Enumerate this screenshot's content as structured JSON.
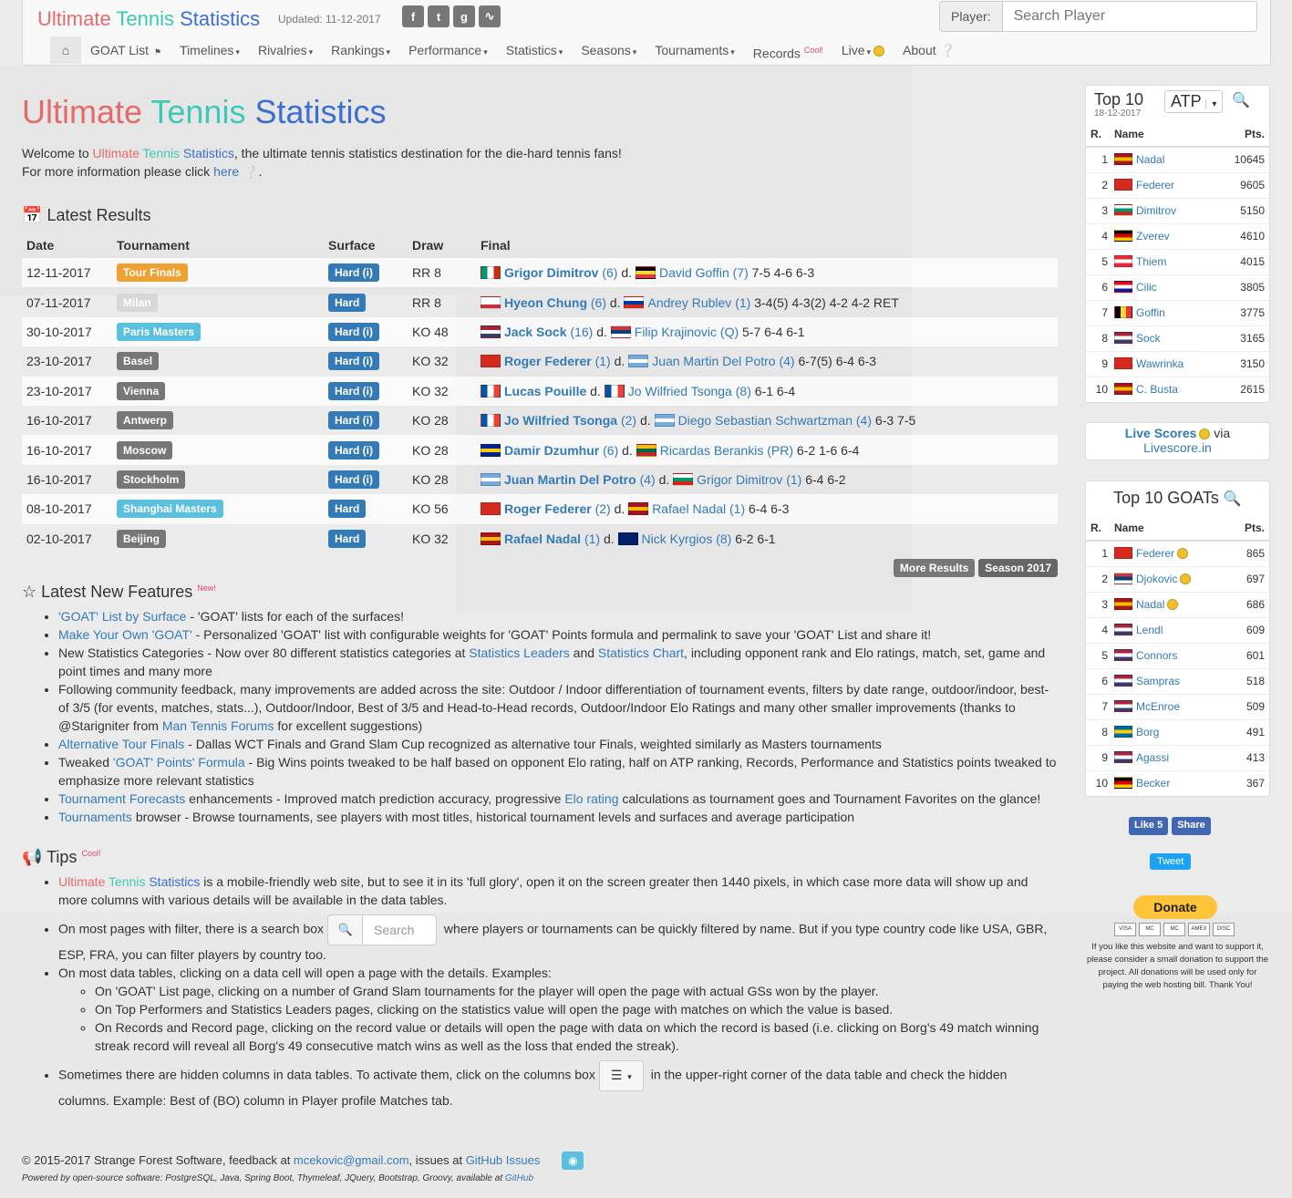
{
  "brand": {
    "part1": "Ultimate ",
    "part2": "Tennis ",
    "part3": "Statistics"
  },
  "updated": "Updated: 11-12-2017",
  "social": [
    "f",
    "t",
    "g",
    "rss"
  ],
  "player_search": {
    "label": "Player:",
    "placeholder": "Search Player"
  },
  "menu": [
    {
      "label": "GOAT List",
      "suffix": "⚑"
    },
    {
      "label": "Timelines",
      "suffix": "▾"
    },
    {
      "label": "Rivalries",
      "suffix": "▾"
    },
    {
      "label": "Rankings",
      "suffix": "▾"
    },
    {
      "label": "Performance",
      "suffix": "▾"
    },
    {
      "label": "Statistics",
      "suffix": "▾"
    },
    {
      "label": "Seasons",
      "suffix": "▾"
    },
    {
      "label": "Tournaments",
      "suffix": "▾"
    },
    {
      "label": "Records",
      "suffix": ""
    },
    {
      "label": "Live",
      "suffix": "▾"
    },
    {
      "label": "About",
      "suffix": ""
    }
  ],
  "records_badge": "Cool!",
  "intro": {
    "welcome_pre": "Welcome to ",
    "welcome_post": ", the ultimate tennis statistics destination for the die-hard tennis fans!",
    "more_pre": "For more information please click ",
    "more_link": "here"
  },
  "latest_results": {
    "title": "Latest Results",
    "headers": [
      "Date",
      "Tournament",
      "Surface",
      "Draw",
      "Final"
    ],
    "rows": [
      {
        "date": "12-11-2017",
        "tournament": "Tour Finals",
        "tcolor": "lbl-orange",
        "surface": "Hard (i)",
        "draw": "RR 8",
        "wflag": [
          "#00966e",
          "#ffffff",
          "#d62612"
        ],
        "winner": "Grigor Dimitrov",
        "wseed": "(6)",
        "lflag": [
          "#000000",
          "#fdda24",
          "#ef3340"
        ],
        "vert": true,
        "loser": "David Goffin",
        "lseed": "(7)",
        "score": "7-5 4-6 6-3"
      },
      {
        "date": "07-11-2017",
        "tournament": "Milan",
        "tcolor": "lbl-lightgray",
        "surface": "Hard",
        "draw": "RR 8",
        "wflag": [
          "#ffffff",
          "#ffffff",
          "#cd2e3a"
        ],
        "winner": "Hyeon Chung",
        "wseed": "(6)",
        "lflag": [
          "#ffffff",
          "#0039a6",
          "#d52b1e"
        ],
        "loser": "Andrey Rublev",
        "lseed": "(1)",
        "score": "3-4(5) 4-3(2) 4-2 4-2 RET"
      },
      {
        "date": "30-10-2017",
        "tournament": "Paris Masters",
        "tcolor": "lbl-lightblue",
        "surface": "Hard (i)",
        "draw": "KO 48",
        "wflag": [
          "#b22234",
          "#ffffff",
          "#3c3b6e"
        ],
        "winner": "Jack Sock",
        "wseed": "(16)",
        "lflag": [
          "#c6363c",
          "#0c4076",
          "#ffffff"
        ],
        "loser": "Filip Krajinovic",
        "lseed": "(Q)",
        "score": "5-7 6-4 6-1"
      },
      {
        "date": "23-10-2017",
        "tournament": "Basel",
        "tcolor": "lbl-gray",
        "surface": "Hard (i)",
        "draw": "KO 32",
        "wflag": [
          "#d52b1e",
          "#d52b1e",
          "#d52b1e"
        ],
        "winner": "Roger Federer",
        "wseed": "(1)",
        "lflag": [
          "#74acdf",
          "#ffffff",
          "#74acdf"
        ],
        "loser": "Juan Martin Del Potro",
        "lseed": "(4)",
        "score": "6-7(5) 6-4 6-3"
      },
      {
        "date": "23-10-2017",
        "tournament": "Vienna",
        "tcolor": "lbl-gray",
        "surface": "Hard (i)",
        "draw": "KO 32",
        "wflag": [
          "#0055a4",
          "#ffffff",
          "#ef4135"
        ],
        "vert": true,
        "winner": "Lucas Pouille",
        "wseed": "",
        "lflag": [
          "#0055a4",
          "#ffffff",
          "#ef4135"
        ],
        "lvert": true,
        "loser": "Jo Wilfried Tsonga",
        "lseed": "(8)",
        "score": "6-1 6-4"
      },
      {
        "date": "16-10-2017",
        "tournament": "Antwerp",
        "tcolor": "lbl-gray",
        "surface": "Hard (i)",
        "draw": "KO 28",
        "wflag": [
          "#0055a4",
          "#ffffff",
          "#ef4135"
        ],
        "vert": true,
        "winner": "Jo Wilfried Tsonga",
        "wseed": "(2)",
        "lflag": [
          "#74acdf",
          "#ffffff",
          "#74acdf"
        ],
        "loser": "Diego Sebastian Schwartzman",
        "lseed": "(4)",
        "score": "6-3 7-5"
      },
      {
        "date": "16-10-2017",
        "tournament": "Moscow",
        "tcolor": "lbl-gray",
        "surface": "Hard (i)",
        "draw": "KO 28",
        "wflag": [
          "#002395",
          "#fecb00",
          "#002395"
        ],
        "winner": "Damir Dzumhur",
        "wseed": "(6)",
        "lflag": [
          "#fdb913",
          "#006a44",
          "#c1272d"
        ],
        "loser": "Ricardas Berankis",
        "lseed": "(PR)",
        "score": "6-2 1-6 6-4"
      },
      {
        "date": "16-10-2017",
        "tournament": "Stockholm",
        "tcolor": "lbl-gray",
        "surface": "Hard (i)",
        "draw": "KO 28",
        "wflag": [
          "#74acdf",
          "#ffffff",
          "#74acdf"
        ],
        "winner": "Juan Martin Del Potro",
        "wseed": "(4)",
        "lflag": [
          "#ffffff",
          "#00966e",
          "#d62612"
        ],
        "loser": "Grigor Dimitrov",
        "lseed": "(1)",
        "score": "6-4 6-2"
      },
      {
        "date": "08-10-2017",
        "tournament": "Shanghai Masters",
        "tcolor": "lbl-lightblue",
        "surface": "Hard",
        "draw": "KO 56",
        "wflag": [
          "#d52b1e",
          "#d52b1e",
          "#d52b1e"
        ],
        "winner": "Roger Federer",
        "wseed": "(2)",
        "lflag": [
          "#aa151b",
          "#f1bf00",
          "#aa151b"
        ],
        "loser": "Rafael Nadal",
        "lseed": "(1)",
        "score": "6-4 6-3"
      },
      {
        "date": "02-10-2017",
        "tournament": "Beijing",
        "tcolor": "lbl-gray",
        "surface": "Hard",
        "draw": "KO 32",
        "wflag": [
          "#aa151b",
          "#f1bf00",
          "#aa151b"
        ],
        "winner": "Rafael Nadal",
        "wseed": "(1)",
        "lflag": [
          "#012169",
          "#012169",
          "#012169"
        ],
        "loser": "Nick Kyrgios",
        "lseed": "(8)",
        "score": "6-2 6-1"
      }
    ],
    "d_label": "d.",
    "more_results": "More Results",
    "season": "Season 2017"
  },
  "features": {
    "title": "Latest New Features",
    "badge": "New!",
    "items": [
      [
        {
          "t": "'GOAT' List by Surface",
          "l": true
        },
        {
          "t": " - 'GOAT' lists for each of the surfaces!"
        }
      ],
      [
        {
          "t": "Make Your Own 'GOAT'",
          "l": true
        },
        {
          "t": " - Personalized 'GOAT' list with configurable weights for 'GOAT' Points formula and permalink to save your 'GOAT' List and share it!"
        }
      ],
      [
        {
          "t": "New Statistics Categories - Now over 80 different statistics categories at "
        },
        {
          "t": "Statistics Leaders",
          "l": true
        },
        {
          "t": " and "
        },
        {
          "t": "Statistics Chart",
          "l": true
        },
        {
          "t": ", including opponent rank and Elo ratings, match, set, game and point times and many more"
        }
      ],
      [
        {
          "t": "Following community feedback, many improvements are added across the site: Outdoor / Indoor differentiation of tournament events, filters by date range, outdoor/indoor, best-of 3/5 (for events, matches, stats...), Outdoor/Indoor, Best of 3/5 and Head-to-Head records, Outdoor/Indoor Elo Ratings and many other smaller improvements (thanks to @Starigniter from "
        },
        {
          "t": "Man Tennis Forums",
          "l": true
        },
        {
          "t": " for excellent suggestions)"
        }
      ],
      [
        {
          "t": "Alternative Tour Finals",
          "l": true
        },
        {
          "t": " - Dallas WCT Finals and Grand Slam Cup recognized as alternative tour Finals, weighted similarly as Masters tournaments"
        }
      ],
      [
        {
          "t": "Tweaked "
        },
        {
          "t": "'GOAT' Points' Formula",
          "l": true
        },
        {
          "t": " - Big Wins points tweaked to be half based on opponent Elo rating, half on ATP ranking, Records, Performance and Statistics points tweaked to emphasize more relevant statistics"
        }
      ],
      [
        {
          "t": "Tournament Forecasts",
          "l": true
        },
        {
          "t": " enhancements - Improved match prediction accuracy, progressive "
        },
        {
          "t": "Elo rating",
          "l": true
        },
        {
          "t": " calculations as tournament goes and Tournament Favorites on the glance!"
        }
      ],
      [
        {
          "t": "Tournaments",
          "l": true
        },
        {
          "t": " browser - Browse tournaments, see players with most titles, historical tournament levels and surfaces and average participation"
        }
      ]
    ]
  },
  "tips": {
    "title": "Tips",
    "badge": "Cool!",
    "t1": " is a mobile-friendly web site, but to see it in its 'full glory', open it on the screen greater then 1440 pixels, in which case more data will show up and more columns with various details will be available in the data tables.",
    "t2a": "On most pages with filter, there is a search box",
    "t2_placeholder": "Search",
    "t2b": " where players or tournaments can be quickly filtered by name. But if you type country code like USA, GBR, ESP, FRA, you can filter players by country too.",
    "t3": "On most data tables, clicking on a data cell will open a page with the details. Examples:",
    "sub": [
      "On 'GOAT' List page, clicking on a number of Grand Slam tournaments for the player will open the page with actual GSs won by the player.",
      "On Top Performers and Statistics Leaders pages, clicking on the statistics value will open the page with matches on which the value is based.",
      "On Records and Record page, clicking on the record value or details will open the page with data on which the record is based (i.e. clicking on Borg's 49 match winning streak record will reveal all Borg's 49 consecutive match wins as well as the loss that ended the streak)."
    ],
    "t4a": "Sometimes there are hidden columns in data tables. To activate them, click on the columns box",
    "t4b": " in the upper-right corner of the data table and check the hidden columns. Example: Best of (BO) column in Player profile Matches tab."
  },
  "footer": {
    "copy": "© 2015-2017 Strange Forest Software, feedback at ",
    "email": "mcekovic@gmail.com",
    "issues_pre": ", issues at ",
    "issues": "GitHub Issues",
    "powered": "Powered by open-source software: PostgreSQL, Java, Spring Boot, Thymeleaf, JQuery, Bootstrap, Groovy, available at ",
    "powered_link": "GitHub"
  },
  "top10": {
    "title": "Top 10",
    "date": "18-12-2017",
    "select": "ATP",
    "headers": [
      "R.",
      "Name",
      "Pts."
    ],
    "rows": [
      {
        "r": "1",
        "name": "Nadal",
        "pts": "10645",
        "flag": [
          "#aa151b",
          "#f1bf00",
          "#aa151b"
        ]
      },
      {
        "r": "2",
        "name": "Federer",
        "pts": "9605",
        "flag": [
          "#d52b1e",
          "#d52b1e",
          "#d52b1e"
        ]
      },
      {
        "r": "3",
        "name": "Dimitrov",
        "pts": "5150",
        "flag": [
          "#ffffff",
          "#00966e",
          "#d62612"
        ]
      },
      {
        "r": "4",
        "name": "Zverev",
        "pts": "4610",
        "flag": [
          "#000000",
          "#dd0000",
          "#ffce00"
        ]
      },
      {
        "r": "5",
        "name": "Thiem",
        "pts": "4015",
        "flag": [
          "#ed2939",
          "#ffffff",
          "#ed2939"
        ]
      },
      {
        "r": "6",
        "name": "Cilic",
        "pts": "3805",
        "flag": [
          "#ff0000",
          "#ffffff",
          "#171796"
        ]
      },
      {
        "r": "7",
        "name": "Goffin",
        "pts": "3775",
        "flag": [
          "#000000",
          "#fdda24",
          "#ef3340"
        ],
        "vert": true
      },
      {
        "r": "8",
        "name": "Sock",
        "pts": "3165",
        "flag": [
          "#b22234",
          "#ffffff",
          "#3c3b6e"
        ]
      },
      {
        "r": "9",
        "name": "Wawrinka",
        "pts": "3150",
        "flag": [
          "#d52b1e",
          "#d52b1e",
          "#d52b1e"
        ]
      },
      {
        "r": "10",
        "name": "C. Busta",
        "pts": "2615",
        "flag": [
          "#aa151b",
          "#f1bf00",
          "#aa151b"
        ]
      }
    ]
  },
  "live": {
    "label": "Live Scores",
    "via": " via",
    "site": "Livescore.in"
  },
  "goats": {
    "title": "Top 10 GOATs",
    "headers": [
      "R.",
      "Name",
      "Pts."
    ],
    "rows": [
      {
        "r": "1",
        "name": "Federer",
        "pts": "865",
        "coin": true,
        "flag": [
          "#d52b1e",
          "#d52b1e",
          "#d52b1e"
        ]
      },
      {
        "r": "2",
        "name": "Djokovic",
        "pts": "697",
        "coin": true,
        "flag": [
          "#c6363c",
          "#0c4076",
          "#ffffff"
        ]
      },
      {
        "r": "3",
        "name": "Nadal",
        "pts": "686",
        "coin": true,
        "flag": [
          "#aa151b",
          "#f1bf00",
          "#aa151b"
        ]
      },
      {
        "r": "4",
        "name": "Lendl",
        "pts": "609",
        "flag": [
          "#b22234",
          "#ffffff",
          "#3c3b6e"
        ]
      },
      {
        "r": "5",
        "name": "Connors",
        "pts": "601",
        "flag": [
          "#b22234",
          "#ffffff",
          "#3c3b6e"
        ]
      },
      {
        "r": "6",
        "name": "Sampras",
        "pts": "518",
        "flag": [
          "#b22234",
          "#ffffff",
          "#3c3b6e"
        ]
      },
      {
        "r": "7",
        "name": "McEnroe",
        "pts": "509",
        "flag": [
          "#b22234",
          "#ffffff",
          "#3c3b6e"
        ]
      },
      {
        "r": "8",
        "name": "Borg",
        "pts": "491",
        "flag": [
          "#006aa7",
          "#fecc00",
          "#006aa7"
        ]
      },
      {
        "r": "9",
        "name": "Agassi",
        "pts": "413",
        "flag": [
          "#b22234",
          "#ffffff",
          "#3c3b6e"
        ]
      },
      {
        "r": "10",
        "name": "Becker",
        "pts": "367",
        "flag": [
          "#000000",
          "#dd0000",
          "#ffce00"
        ]
      }
    ]
  },
  "social_buttons": {
    "like": "Like 5",
    "share": "Share",
    "tweet": "Tweet"
  },
  "donate": {
    "label": "Donate",
    "cards": [
      "VISA",
      "MC",
      "MC",
      "AMEX",
      "DISC"
    ],
    "text": "If you like this website and want to support it, please consider a small donation to support the project. All donations will be used only for paying the web hosting bill. Thank You!"
  }
}
